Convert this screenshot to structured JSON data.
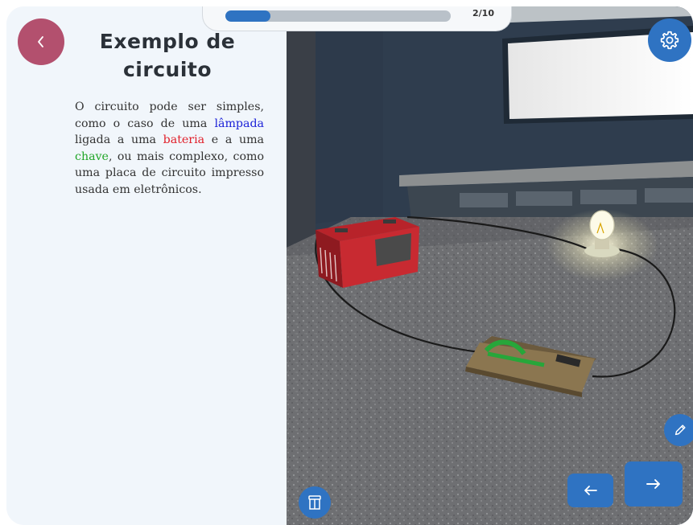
{
  "header": {
    "progress_label": "2/10",
    "progress_fraction": 0.2
  },
  "panel": {
    "title_line1": "Exemplo de",
    "title_line2": "circuito",
    "desc": {
      "part1": "O circuito pode ser simples, como o caso de uma ",
      "lamp": "lâmpada",
      "part2": " ligada a uma ",
      "battery": "bateria",
      "part3": " e a uma ",
      "switch": "chave",
      "part4": ", ou mais complexo, como uma placa de circuito impresso usada em eletrônicos."
    }
  },
  "icons": {
    "back": "chevron-left-icon",
    "settings": "gear-icon",
    "pencil": "pencil-icon",
    "book": "book-icon",
    "prev": "arrow-left-icon",
    "next": "arrow-right-icon"
  },
  "colors": {
    "accent": "#2f73c2",
    "back_button": "#b3506e",
    "lamp_word": "#1d22d8",
    "battery_word": "#e11f2a",
    "switch_word": "#21a628",
    "panel_bg": "#f1f6fb"
  }
}
